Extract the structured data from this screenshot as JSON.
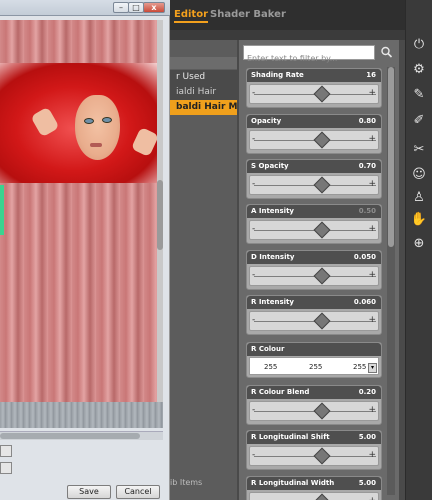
{
  "app": {
    "tabs": [
      {
        "label": "Editor"
      },
      {
        "label": "Shader Baker"
      }
    ]
  },
  "material_list": {
    "items": [
      {
        "label": "r Used"
      },
      {
        "label": "ialdi Hair"
      },
      {
        "label": "baldi Hair Ma..."
      }
    ],
    "footer": "ib Items"
  },
  "filter": {
    "placeholder": "Enter text to filter by..."
  },
  "properties": [
    {
      "name": "Shading Rate",
      "value": "16",
      "fraction": 0.55,
      "dim": false
    },
    {
      "name": "Opacity",
      "value": "0.80",
      "fraction": 0.55,
      "dim": false
    },
    {
      "name": "S Opacity",
      "value": "0.70",
      "fraction": 0.55,
      "dim": false
    },
    {
      "name": "A Intensity",
      "value": "0.50",
      "fraction": 0.55,
      "dim": true
    },
    {
      "name": "D Intensity",
      "value": "0.050",
      "fraction": 0.55,
      "dim": false
    },
    {
      "name": "R Intensity",
      "value": "0.060",
      "fraction": 0.55,
      "dim": false
    }
  ],
  "colour": {
    "name": "R Colour",
    "r": "255",
    "g": "255",
    "b": "255"
  },
  "properties2": [
    {
      "name": "R Colour Blend",
      "value": "0.20",
      "fraction": 0.55
    },
    {
      "name": "R Longitudinal Shift",
      "value": "5.00",
      "fraction": 0.55
    },
    {
      "name": "R Longitudinal Width",
      "value": "5.00",
      "fraction": 0.55
    }
  ],
  "window": {
    "minimize": "–",
    "maximize": "□",
    "close": "x",
    "save_label": "Save",
    "cancel_label": "Cancel"
  },
  "rail_icons": [
    "power-icon",
    "figure-edit-icon",
    "material-edit-icon",
    "pencil-icon",
    "brush-icon",
    "pose-icon",
    "morph-icon",
    "hand-icon",
    "globe-icon"
  ]
}
